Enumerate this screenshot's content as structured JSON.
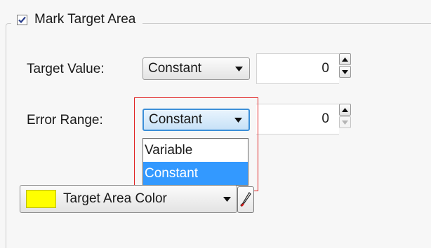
{
  "group": {
    "checkbox_checked": true,
    "title": "Mark Target Area"
  },
  "target_value": {
    "label": "Target Value:",
    "mode": "Constant",
    "value": "0"
  },
  "error_range": {
    "label": "Error Range:",
    "mode": "Constant",
    "value": "0",
    "dropdown_options": [
      "Variable",
      "Constant"
    ],
    "dropdown_selected": "Constant"
  },
  "target_area_color": {
    "label": "Target Area Color",
    "swatch_color": "#FFFF00"
  },
  "colors": {
    "highlight_border": "#E02424",
    "selection": "#3399FF",
    "focus": "#3C8FD8"
  }
}
